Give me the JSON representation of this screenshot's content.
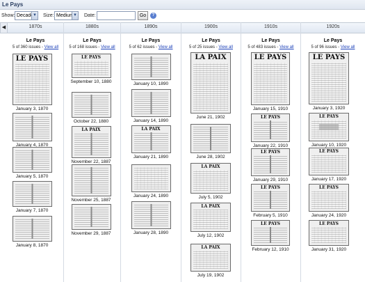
{
  "title": "Le Pays",
  "toolbar": {
    "show_label": "Show:",
    "show_value": "Decade",
    "size_label": "Size:",
    "size_value": "Medium",
    "date_label": "Date:",
    "date_value": "",
    "go_label": "Go",
    "help_icon": "question-icon"
  },
  "nav": {
    "prev_icon": "left-arrow-icon",
    "prev_glyph": "◀"
  },
  "columns": [
    {
      "decade": "1870s",
      "paper": "Le Pays",
      "count": "5 of 360 issues - ",
      "view_all": "View all",
      "issues": [
        {
          "date": "January 3, 1870",
          "masthead": "LE PAYS"
        },
        {
          "date": "January 4, 1870",
          "masthead": ""
        },
        {
          "date": "January 5, 1870",
          "masthead": ""
        },
        {
          "date": "January 7, 1870",
          "masthead": ""
        },
        {
          "date": "January 8, 1870",
          "masthead": ""
        }
      ]
    },
    {
      "decade": "1880s",
      "paper": "Le Pays",
      "count": "5 of 168 issues - ",
      "view_all": "View all",
      "issues": [
        {
          "date": "September 10, 1880",
          "masthead": "LE PAYS"
        },
        {
          "date": "October 22, 1880",
          "masthead": ""
        },
        {
          "date": "November 22, 1887",
          "masthead": "LA PAIX"
        },
        {
          "date": "November 25, 1887",
          "masthead": ""
        },
        {
          "date": "November 29, 1887",
          "masthead": ""
        }
      ]
    },
    {
      "decade": "1890s",
      "paper": "Le Pays",
      "count": "5 of 62 issues - ",
      "view_all": "View all",
      "issues": [
        {
          "date": "January 10, 1890",
          "masthead": ""
        },
        {
          "date": "January 14, 1890",
          "masthead": ""
        },
        {
          "date": "January 21, 1890",
          "masthead": "LA PAIX"
        },
        {
          "date": "January 24, 1890",
          "masthead": ""
        },
        {
          "date": "January 28, 1890",
          "masthead": ""
        }
      ]
    },
    {
      "decade": "1900s",
      "paper": "Le Pays",
      "count": "5 of 25 issues - ",
      "view_all": "View all",
      "issues": [
        {
          "date": "June 21, 1902",
          "masthead": "LA PAIX"
        },
        {
          "date": "June 28, 1902",
          "masthead": ""
        },
        {
          "date": "July 5, 1902",
          "masthead": "LA PAIX"
        },
        {
          "date": "July 12, 1902",
          "masthead": "LA PAIX"
        },
        {
          "date": "July 19, 1902",
          "masthead": "LA PAIX"
        }
      ]
    },
    {
      "decade": "1910s",
      "paper": "Le Pays",
      "count": "5 of 483 issues - ",
      "view_all": "View all",
      "issues": [
        {
          "date": "January 15, 1910",
          "masthead": "LE PAYS"
        },
        {
          "date": "January 22, 1910",
          "masthead": "LE PAYS"
        },
        {
          "date": "January 29, 1910",
          "masthead": "LE PAYS"
        },
        {
          "date": "February 5, 1910",
          "masthead": "LE PAYS"
        },
        {
          "date": "February 12, 1910",
          "masthead": "LE PAYS"
        }
      ]
    },
    {
      "decade": "1920s",
      "paper": "Le Pays",
      "count": "5 of 96 issues - ",
      "view_all": "View all",
      "issues": [
        {
          "date": "January 3, 1920",
          "masthead": "LE PAYS"
        },
        {
          "date": "January 10, 1920",
          "masthead": "LE PAYS"
        },
        {
          "date": "January 17, 1920",
          "masthead": "LE PAYS"
        },
        {
          "date": "January 24, 1920",
          "masthead": "LE PAYS"
        },
        {
          "date": "January 31, 1920",
          "masthead": "LE PAYS"
        }
      ]
    }
  ]
}
